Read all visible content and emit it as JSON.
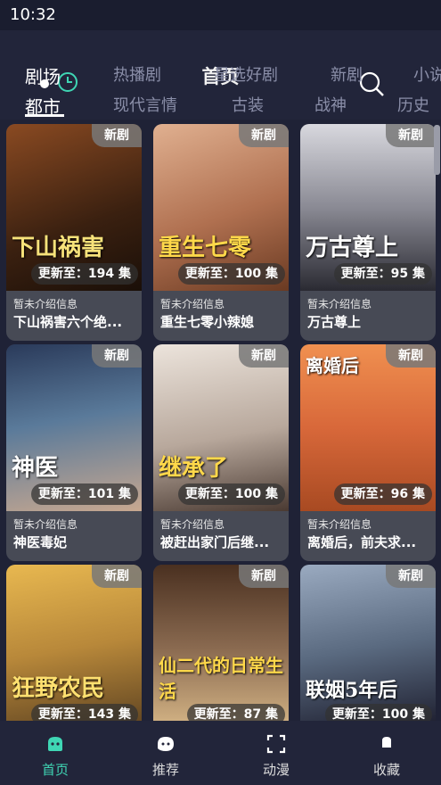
{
  "status": {
    "time": "10:32"
  },
  "header": {
    "title": "首页"
  },
  "tabs": [
    {
      "label": "剧场",
      "active": true
    },
    {
      "label": "热播剧"
    },
    {
      "label": "星选好剧"
    },
    {
      "label": "新剧"
    },
    {
      "label": "小说"
    }
  ],
  "categories": [
    {
      "label": "都市",
      "active": true
    },
    {
      "label": "现代言情"
    },
    {
      "label": "古装"
    },
    {
      "label": "战神"
    },
    {
      "label": "历史"
    }
  ],
  "cards": [
    {
      "badge": "新剧",
      "episodes": "更新至：194 集",
      "desc": "暂未介绍信息",
      "name": "下山祸害六个绝...",
      "poster_text": "下山祸害",
      "colors": [
        "#6b3a1e",
        "#2a1a10"
      ]
    },
    {
      "badge": "新剧",
      "episodes": "更新至：100 集",
      "desc": "暂未介绍信息",
      "name": "重生七零小辣媳",
      "poster_text": "重生七零",
      "colors": [
        "#c98b6a",
        "#7a4a32"
      ]
    },
    {
      "badge": "新剧",
      "episodes": "更新至：95 集",
      "desc": "暂未介绍信息",
      "name": "万古尊上",
      "poster_text": "万古尊上",
      "colors": [
        "#cfcfd6",
        "#3a3a44"
      ]
    },
    {
      "badge": "新剧",
      "episodes": "更新至：101 集",
      "desc": "暂未介绍信息",
      "name": "神医毒妃",
      "poster_text": "神医",
      "colors": [
        "#3a5a7a",
        "#a08a70"
      ]
    },
    {
      "badge": "新剧",
      "episodes": "更新至：100 集",
      "desc": "暂未介绍信息",
      "name": "被赶出家门后继...",
      "poster_text": "继承了",
      "colors": [
        "#d8d0c8",
        "#5a4a40"
      ]
    },
    {
      "badge": "新剧",
      "episodes": "更新至：96 集",
      "desc": "暂未介绍信息",
      "name": "离婚后，前夫求...",
      "poster_text": "离婚后",
      "colors": [
        "#e07a3a",
        "#b84a20"
      ]
    },
    {
      "badge": "新剧",
      "episodes": "更新至：143 集",
      "desc": "",
      "name": "",
      "poster_text": "狂野农民",
      "colors": [
        "#d8a040",
        "#6a5020"
      ]
    },
    {
      "badge": "新剧",
      "episodes": "更新至：87 集",
      "desc": "",
      "name": "",
      "poster_text": "仙二代的日常生活",
      "colors": [
        "#5a3a2a",
        "#c8a070"
      ]
    },
    {
      "badge": "新剧",
      "episodes": "更新至：100 集",
      "desc": "",
      "name": "",
      "poster_text": "联姻5年后",
      "colors": [
        "#7a8aa0",
        "#2a2a3a"
      ]
    }
  ],
  "nav": [
    {
      "label": "首页",
      "icon": "home-icon",
      "active": true
    },
    {
      "label": "推荐",
      "icon": "recommend-icon"
    },
    {
      "label": "动漫",
      "icon": "anime-icon"
    },
    {
      "label": "收藏",
      "icon": "favorites-icon"
    }
  ],
  "colors": {
    "accent": "#3fd6b4",
    "bg": "#1f2236"
  }
}
